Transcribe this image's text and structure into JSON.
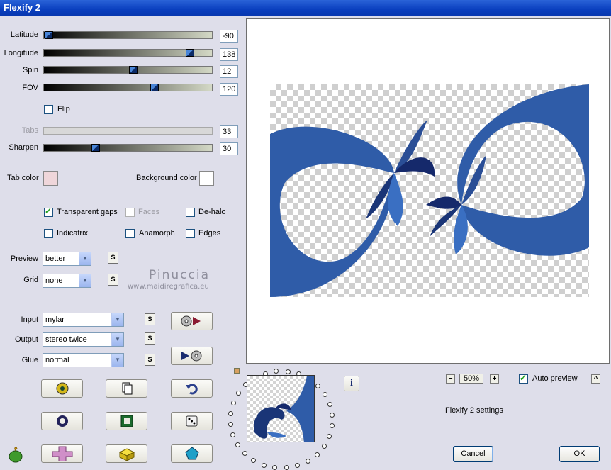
{
  "window": {
    "title": "Flexify 2"
  },
  "sliders": [
    {
      "label": "Latitude",
      "value": "-90",
      "level": 0.03
    },
    {
      "label": "Longitude",
      "value": "138",
      "level": 0.87
    },
    {
      "label": "Spin",
      "value": "12",
      "level": 0.53
    },
    {
      "label": "FOV",
      "value": "120",
      "level": 0.66
    }
  ],
  "flip": {
    "label": "Flip",
    "checked": false
  },
  "tabs": {
    "label": "Tabs",
    "value": "33",
    "enabled": false
  },
  "sharpen": {
    "label": "Sharpen",
    "value": "30",
    "level": 0.31
  },
  "colors": {
    "tab_color_label": "Tab color",
    "tab_color": "#efd6da",
    "background_color_label": "Background color",
    "background_color": "#ffffff"
  },
  "options": {
    "transparent_gaps": {
      "label": "Transparent gaps",
      "checked": true
    },
    "faces": {
      "label": "Faces",
      "checked": false,
      "enabled": false
    },
    "de_halo": {
      "label": "De-halo",
      "checked": false
    },
    "indicatrix": {
      "label": "Indicatrix",
      "checked": false
    },
    "anamorph": {
      "label": "Anamorph",
      "checked": false
    },
    "edges": {
      "label": "Edges",
      "checked": false
    }
  },
  "preview_select": {
    "label": "Preview",
    "value": "better"
  },
  "grid_select": {
    "label": "Grid",
    "value": "none"
  },
  "input_select": {
    "label": "Input",
    "value": "mylar"
  },
  "output_select": {
    "label": "Output",
    "value": "stereo twice"
  },
  "glue_select": {
    "label": "Glue",
    "value": "normal"
  },
  "s_button": "S",
  "watermark": {
    "line1": "Pinuccia",
    "line2": "www.maidiregrafica.eu"
  },
  "zoom": {
    "minus": "−",
    "value": "50%",
    "plus": "+"
  },
  "auto_preview": {
    "label": "Auto preview",
    "checked": true
  },
  "status": {
    "text": "Flexify 2 settings"
  },
  "buttons": {
    "cancel": "Cancel",
    "ok": "OK",
    "info": "i",
    "collapse": "^"
  },
  "colors_accent": {
    "blue": "#2f5ca8",
    "title_bar": "#0a3fbf"
  }
}
